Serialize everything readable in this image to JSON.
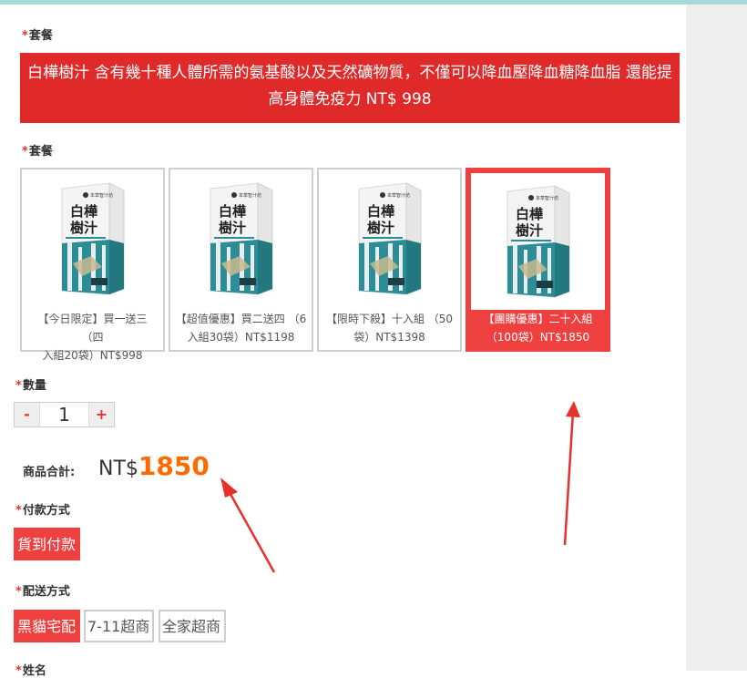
{
  "package_label": "套餐",
  "banner": {
    "line1": "白樺樹汁 含有幾十種人體所需的氨基酸以及天然礦物質，不僅可以降血壓降血糖降血脂 還能提",
    "line2": "高身體免疫力 NT$ 998"
  },
  "package_label_2": "套餐",
  "product_box": {
    "brand": "本草智汁坊",
    "title_line1": "白樺",
    "title_line2": "樹汁"
  },
  "packages": [
    {
      "line1": "【今日限定】買一送三 （四",
      "line2": "入組20袋）NT$998",
      "selected": false
    },
    {
      "line1": "【超值優惠】買二送四 （6",
      "line2": "入組30袋）NT$1198",
      "selected": false
    },
    {
      "line1": "【限時下殺】十入組 （50",
      "line2": "袋）NT$1398",
      "selected": false
    },
    {
      "line1": "【團購優惠】二十入組",
      "line2": "（100袋）NT$1850",
      "selected": true
    }
  ],
  "quantity": {
    "label": "數量",
    "minus": "-",
    "value": "1",
    "plus": "+"
  },
  "subtotal": {
    "label": "商品合計:",
    "currency": "NT$",
    "amount": "1850"
  },
  "payment": {
    "label": "付款方式",
    "options": [
      "貨到付款"
    ],
    "selected_index": 0
  },
  "shipping": {
    "label": "配送方式",
    "options": [
      "黑貓宅配",
      "7-11超商",
      "全家超商"
    ],
    "selected_index": 0
  },
  "name_label": "姓名",
  "colors": {
    "accent_red": "#ef4040",
    "banner_red": "#e02a2a",
    "price_orange": "#ff6a00",
    "arrow_red": "#e8302a"
  }
}
